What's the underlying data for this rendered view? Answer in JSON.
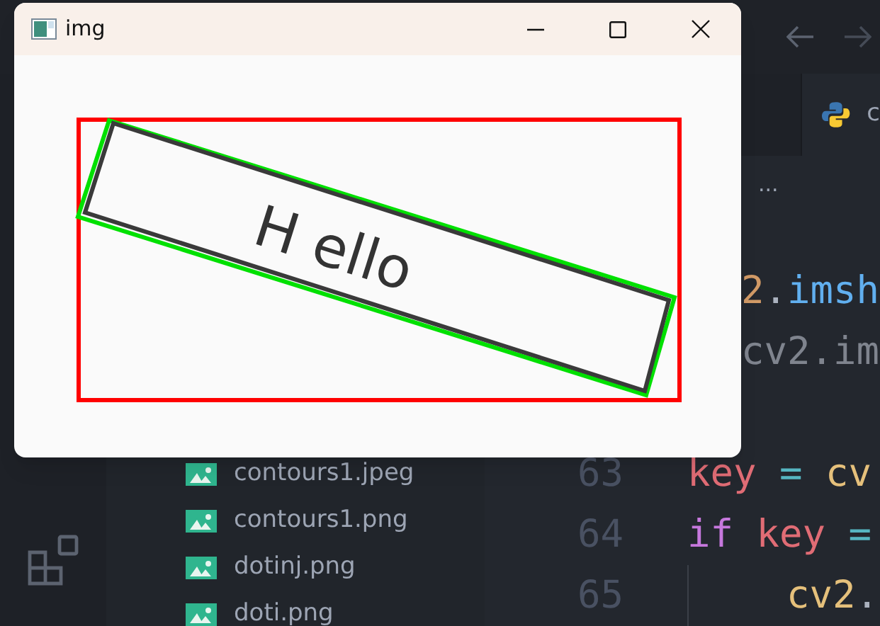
{
  "image_window": {
    "title": "img",
    "controls": [
      {
        "kind": "minimize"
      },
      {
        "kind": "maximize"
      },
      {
        "kind": "close"
      }
    ],
    "image": {
      "text": "H ello"
    }
  },
  "nav": [
    {
      "kind": "back"
    },
    {
      "kind": "forward"
    }
  ],
  "explorer": {
    "files": [
      {
        "name": "contours1.jpeg"
      },
      {
        "name": "contours1.png"
      },
      {
        "name": "dotinj.png"
      },
      {
        "name": "doti.png"
      }
    ]
  },
  "editor": {
    "tab": {
      "label": "c"
    },
    "breadcrumb": "...",
    "lines": [
      {
        "clipped": true,
        "indent": false,
        "spaced": false,
        "tokens": [
          {
            "text": "2",
            "kind": "number"
          },
          {
            "text": ".",
            "kind": "punctuation"
          },
          {
            "text": "imsh",
            "kind": "function"
          }
        ]
      },
      {
        "clipped": true,
        "indent": false,
        "spaced": false,
        "tokens": [
          {
            "text": "cv2.im",
            "kind": "comment"
          }
        ]
      },
      {
        "number": "63",
        "clipped": false,
        "indent": false,
        "spaced": true,
        "tokens": [
          {
            "text": "key",
            "kind": "variable"
          },
          {
            "text": "=",
            "kind": "operator"
          },
          {
            "text": "cv",
            "kind": "module"
          }
        ]
      },
      {
        "number": "64",
        "clipped": false,
        "indent": false,
        "spaced": true,
        "tokens": [
          {
            "text": "if",
            "kind": "keyword"
          },
          {
            "text": "key",
            "kind": "variable"
          },
          {
            "text": "=",
            "kind": "operator"
          }
        ]
      },
      {
        "number": "65",
        "clipped": false,
        "indent": true,
        "spaced": false,
        "tokens": [
          {
            "text": "cv2",
            "kind": "module"
          },
          {
            "text": ".",
            "kind": "punctuation"
          }
        ]
      }
    ]
  }
}
